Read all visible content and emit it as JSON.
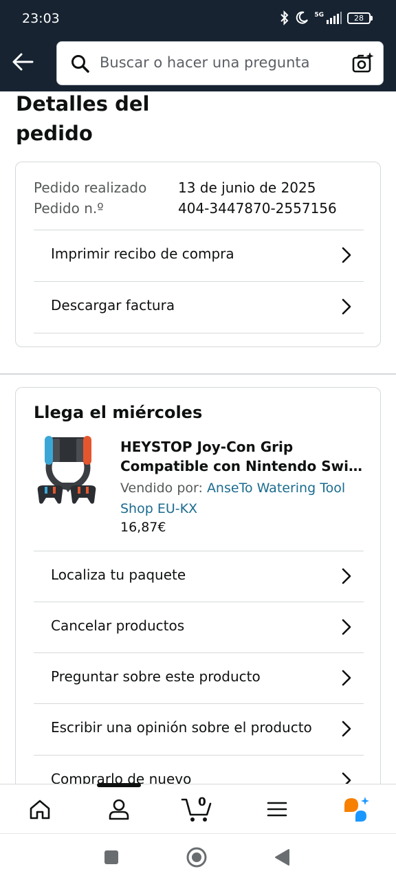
{
  "status_bar": {
    "time": "23:03",
    "network": "5G",
    "battery": "28"
  },
  "header": {
    "search_placeholder": "Buscar o hacer una pregunta"
  },
  "page": {
    "title": "Detalles del pedido"
  },
  "order_info": {
    "rows": [
      {
        "label": "Pedido realizado",
        "value": "13 de junio de 2025"
      },
      {
        "label": "Pedido n.º",
        "value": "404-3447870-2557156"
      }
    ],
    "actions": [
      {
        "label": "Imprimir recibo de compra"
      },
      {
        "label": "Descargar factura"
      }
    ]
  },
  "delivery": {
    "title": "Llega el miércoles",
    "product": {
      "title_line1": "HEYSTOP Joy-Con Grip",
      "title_line2": "Compatible con Nintendo Switc...",
      "sold_by_label": "Vendido por:",
      "seller": "AnseTo Watering Tool Shop EU-KX",
      "price": "16,87€"
    },
    "actions": [
      {
        "label": "Localiza tu paquete"
      },
      {
        "label": "Cancelar productos"
      },
      {
        "label": "Preguntar sobre este producto"
      },
      {
        "label": "Escribir una opinión sobre el producto"
      },
      {
        "label": "Comprarlo de nuevo"
      }
    ]
  },
  "bottom_nav": {
    "items": [
      "home-icon",
      "account-icon",
      "cart-icon",
      "menu-icon",
      "rufus-icon"
    ],
    "cart_count": "0",
    "active": "account"
  },
  "colors": {
    "header_bg": "#172331",
    "link": "#1a6b8f",
    "rufus_orange": "#f78000",
    "rufus_blue": "#1a98ff"
  }
}
